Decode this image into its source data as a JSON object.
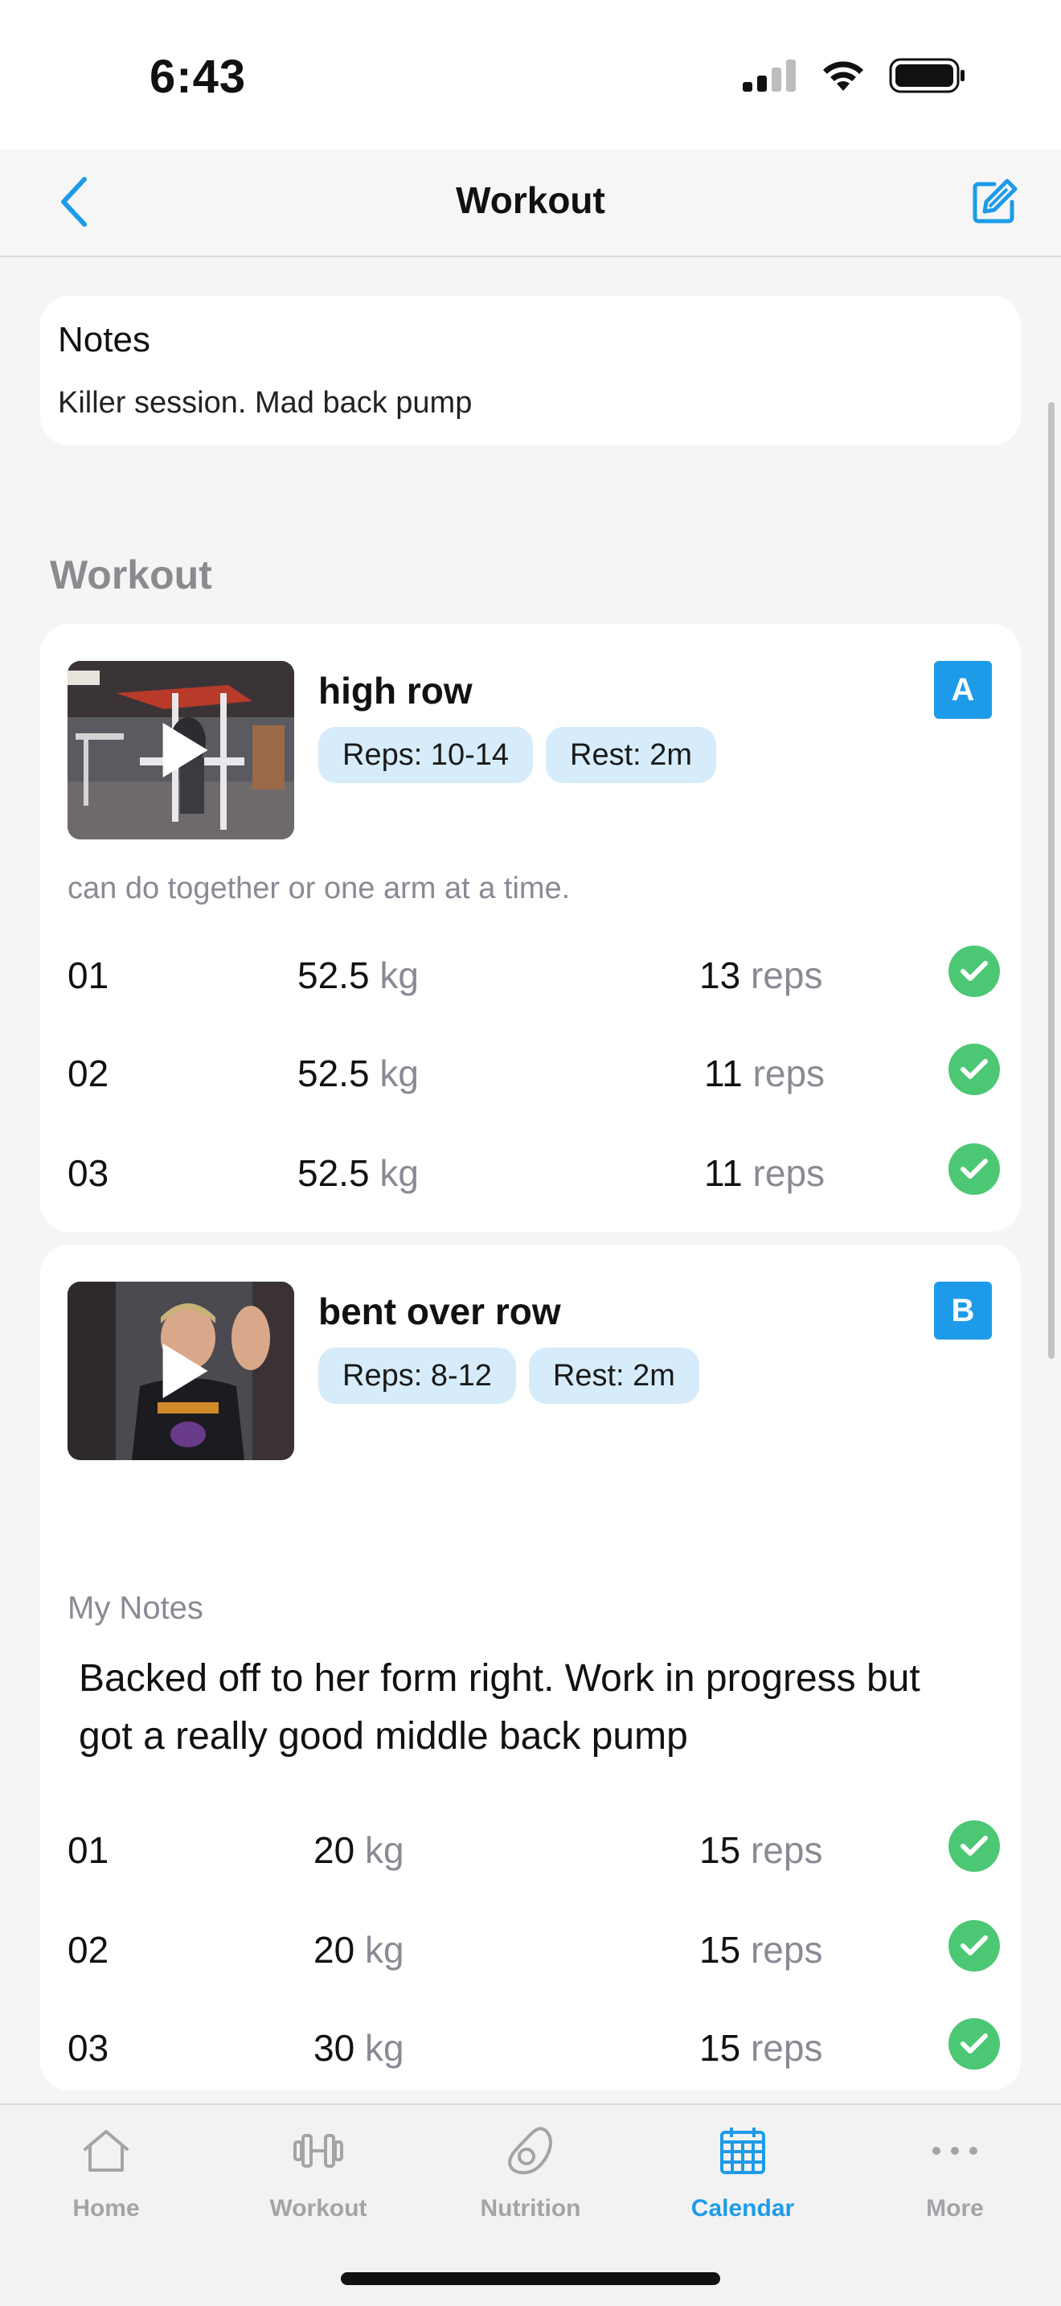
{
  "status": {
    "time": "6:43"
  },
  "header": {
    "title": "Workout"
  },
  "notes": {
    "title": "Notes",
    "text": "Killer session. Mad back pump"
  },
  "section": {
    "title": "Workout"
  },
  "exercises": [
    {
      "name": "high row",
      "badge": "A",
      "reps_chip": "Reps: 10-14",
      "rest_chip": "Rest: 2m",
      "description": "can do together or one arm at a time.",
      "sets": [
        {
          "num": "01",
          "weight": "52.5",
          "weight_unit": "kg",
          "reps": "13",
          "reps_unit": "reps"
        },
        {
          "num": "02",
          "weight": "52.5",
          "weight_unit": "kg",
          "reps": "11",
          "reps_unit": "reps"
        },
        {
          "num": "03",
          "weight": "52.5",
          "weight_unit": "kg",
          "reps": "11",
          "reps_unit": "reps"
        }
      ]
    },
    {
      "name": "bent over row",
      "badge": "B",
      "reps_chip": "Reps: 8-12",
      "rest_chip": "Rest: 2m",
      "my_notes_label": "My Notes",
      "my_notes": "Backed off to her form right. Work in progress but got a really good middle back pump",
      "sets": [
        {
          "num": "01",
          "weight": "20",
          "weight_unit": "kg",
          "reps": "15",
          "reps_unit": "reps"
        },
        {
          "num": "02",
          "weight": "20",
          "weight_unit": "kg",
          "reps": "15",
          "reps_unit": "reps"
        },
        {
          "num": "03",
          "weight": "30",
          "weight_unit": "kg",
          "reps": "15",
          "reps_unit": "reps"
        }
      ]
    }
  ],
  "tabs": [
    {
      "label": "Home",
      "icon": "home-icon"
    },
    {
      "label": "Workout",
      "icon": "dumbbell-icon"
    },
    {
      "label": "Nutrition",
      "icon": "avocado-icon"
    },
    {
      "label": "Calendar",
      "icon": "calendar-icon"
    },
    {
      "label": "More",
      "icon": "more-icon"
    }
  ],
  "active_tab": "Calendar",
  "colors": {
    "accent": "#1e9be8",
    "check": "#4cc774",
    "chip": "#d7ecfb"
  }
}
